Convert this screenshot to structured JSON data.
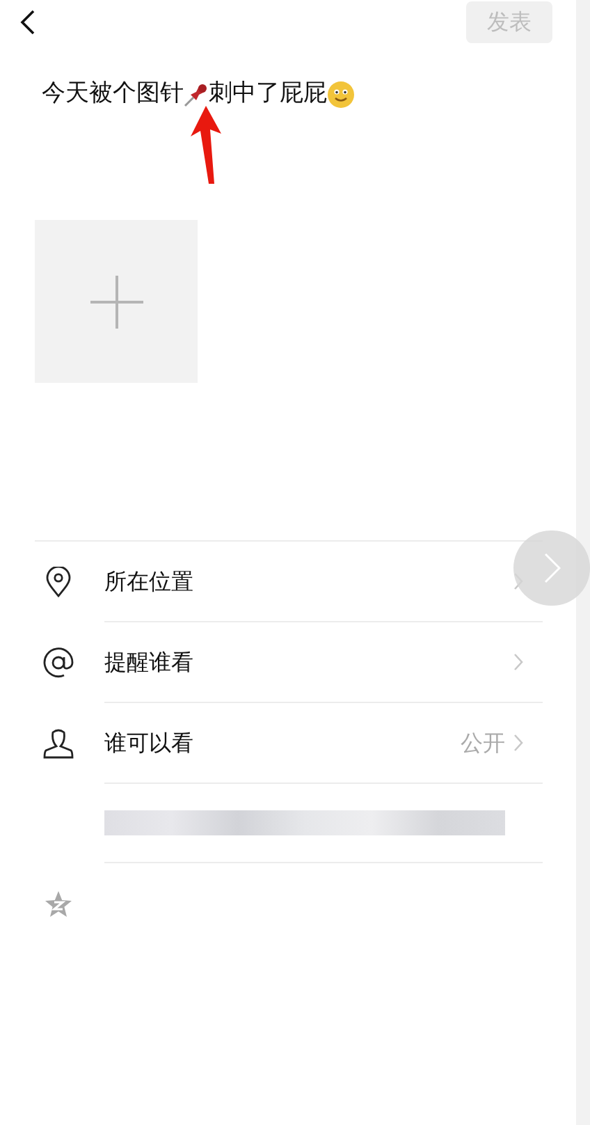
{
  "publish_button": {
    "label": "发表",
    "disabled": true
  },
  "post": {
    "text_parts": [
      "今天被个图针",
      "刺中了屁屁"
    ]
  },
  "options": [
    {
      "kind": "location",
      "label": "所在位置"
    },
    {
      "kind": "mention",
      "label": "提醒谁看"
    },
    {
      "kind": "visibility",
      "label": "谁可以看",
      "value": "公开"
    }
  ]
}
